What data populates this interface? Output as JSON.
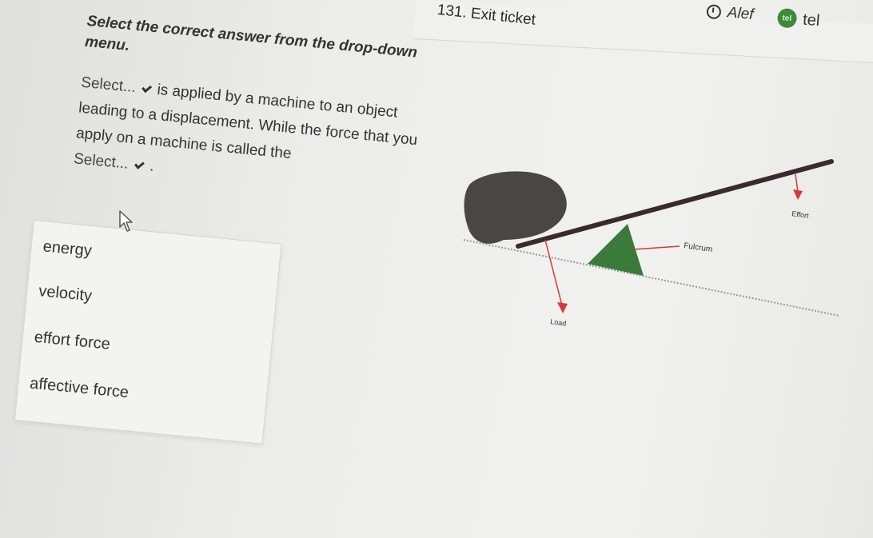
{
  "header": {
    "title": "131. Exit ticket",
    "user_name": "Alef",
    "avatar_text": "tel",
    "user_label": "tel"
  },
  "question": {
    "instruction": "Select the correct answer from the drop-down menu.",
    "select_placeholder_1": "Select...",
    "text_1": "is applied by a machine to an object leading to a displacement. While the force that you apply on a machine is called the",
    "select_placeholder_2": "Select...",
    "text_2": "."
  },
  "dropdown": {
    "options": [
      "energy",
      "velocity",
      "effort force",
      "affective force"
    ]
  },
  "diagram": {
    "labels": {
      "effort": "Effort",
      "fulcrum": "Fulcrum",
      "load": "Load"
    },
    "colors": {
      "lever": "#3a2a2c",
      "rock": "#4a4646",
      "fulcrum": "#3a7a3a",
      "arrow": "#d23a3a",
      "ground": "#9a9a9a"
    }
  }
}
